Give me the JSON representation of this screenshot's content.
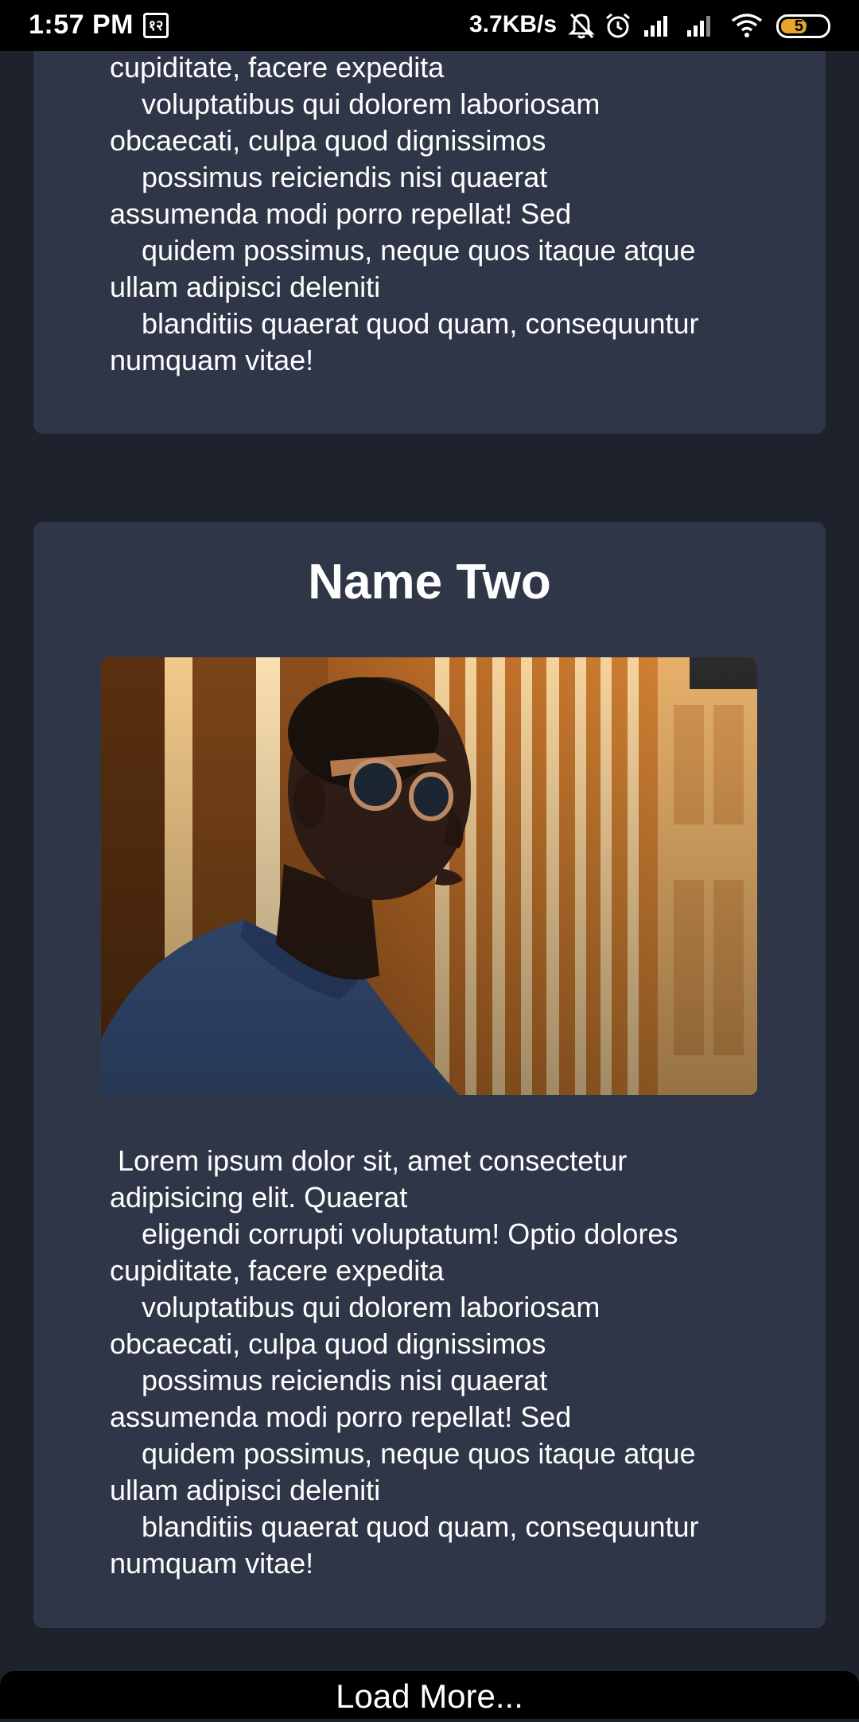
{
  "status_bar": {
    "time": "1:57 PM",
    "notification_glyph": "१२",
    "net_speed": "3.7KB/s",
    "battery_level": 57,
    "battery_text": "57",
    "icons": [
      "mute-bell-icon",
      "alarm-icon",
      "signal-icon",
      "signal-icon",
      "wifi-icon",
      "battery-icon"
    ]
  },
  "cards": [
    {
      "title": "",
      "body": "    eligendi corrupti voluptatum! Optio dolores\ncupiditate, facere expedita\n    voluptatibus qui dolorem laboriosam\nobcaecati, culpa quod dignissimos\n    possimus reiciendis nisi quaerat\nassumenda modi porro repellat! Sed\n    quidem possimus, neque quos itaque atque\nullam adipisci deleniti\n    blanditiis quaerat quod quam, consequuntur\nnumquam vitae!"
    },
    {
      "title": "Name Two",
      "image": "person-with-sunglasses-photo",
      "body": " Lorem ipsum dolor sit, amet consectetur\nadipisicing elit. Quaerat\n    eligendi corrupti voluptatum! Optio dolores\ncupiditate, facere expedita\n    voluptatibus qui dolorem laboriosam\nobcaecati, culpa quod dignissimos\n    possimus reiciendis nisi quaerat\nassumenda modi porro repellat! Sed\n    quidem possimus, neque quos itaque atque\nullam adipisci deleniti\n    blanditiis quaerat quod quam, consequuntur\nnumquam vitae!"
    }
  ],
  "footer": {
    "load_more_label": "Load More..."
  },
  "colors": {
    "page_background": "#1e222c",
    "card_background": "#2f3647",
    "status_bar": "#000000",
    "battery_fill": "#e6a52a"
  }
}
